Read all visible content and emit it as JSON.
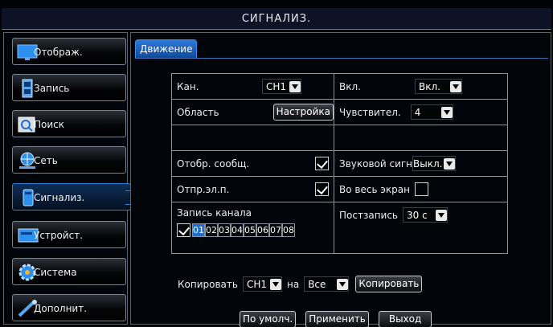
{
  "title": "СИГНАЛИЗ.",
  "sidebar": {
    "items": [
      {
        "label": "Отображ.",
        "icon": "monitor-icon"
      },
      {
        "label": "Запись",
        "icon": "film-icon"
      },
      {
        "label": "Поиск",
        "icon": "magnifier-icon"
      },
      {
        "label": "Сеть",
        "icon": "network-icon"
      },
      {
        "label": "Сигнализ.",
        "icon": "alarm-icon",
        "active": true
      },
      {
        "label": "Устройст.",
        "icon": "hdd-icon"
      },
      {
        "label": "Система",
        "icon": "gear-icon"
      },
      {
        "label": "Дополнит.",
        "icon": "wrench-icon"
      }
    ]
  },
  "tab": {
    "label": "Движение"
  },
  "form": {
    "channel_label": "Кан.",
    "channel_value": "CH1",
    "enable_label": "Вкл.",
    "enable_value": "Вкл.",
    "area_label": "Область",
    "area_button": "Настройка",
    "sensitivity_label": "Чувствител.",
    "sensitivity_value": "4",
    "show_msg_label": "Отобр. сообщ.",
    "show_msg_checked": true,
    "buzzer_label": "Звуковой сигн",
    "buzzer_value": "Выкл.",
    "email_label": "Отпр.эл.п.",
    "email_checked": true,
    "fullscreen_label": "Во весь экран",
    "fullscreen_checked": false,
    "record_channel_label": "Запись канала",
    "postrecord_label": "Постзапись",
    "postrecord_value": "30 с",
    "all_channels_checked": true,
    "channels": [
      "01",
      "02",
      "03",
      "04",
      "05",
      "06",
      "07",
      "08"
    ]
  },
  "copy": {
    "label": "Копировать",
    "from_value": "CH1",
    "to_label": "на",
    "to_value": "Все",
    "button": "Копировать"
  },
  "buttons": {
    "default": "По умолч.",
    "apply": "Применить",
    "exit": "Выход"
  }
}
